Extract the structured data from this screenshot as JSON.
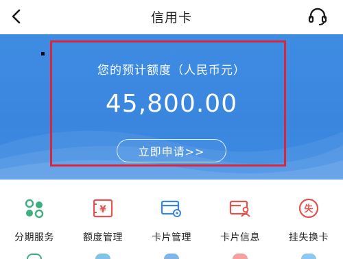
{
  "header": {
    "title": "信用卡"
  },
  "banner": {
    "label": "您的预计额度（人民币元）",
    "amount": "45,800.00",
    "apply_label": "立即申请>>"
  },
  "services": [
    {
      "label": "分期服务",
      "icon": "installment-icon",
      "color": "#3fae7f"
    },
    {
      "label": "额度管理",
      "icon": "limit-management-icon",
      "color": "#e0554f"
    },
    {
      "label": "卡片管理",
      "icon": "card-management-icon",
      "color": "#3a86df"
    },
    {
      "label": "卡片信息",
      "icon": "card-info-icon",
      "color": "#e0554f"
    },
    {
      "label": "挂失换卡",
      "icon": "report-loss-icon",
      "color": "#e0554f"
    }
  ],
  "colors": {
    "banner_blue": "#3a86df",
    "highlight_red": "#d9263a",
    "green_accent": "#3fae7f",
    "red_accent": "#e0554f"
  }
}
